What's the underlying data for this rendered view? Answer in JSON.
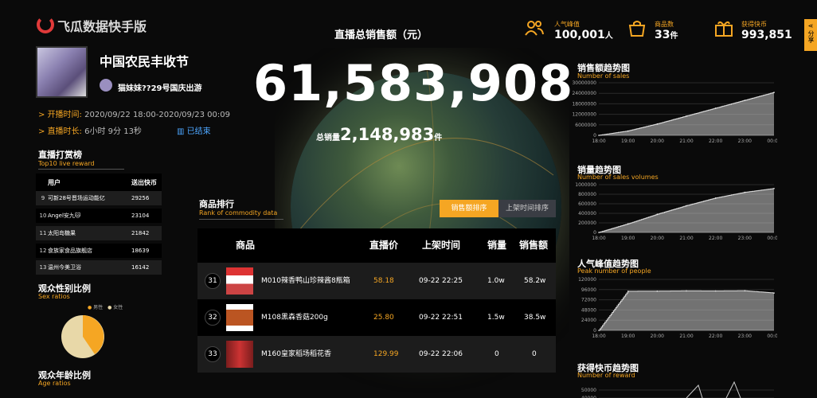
{
  "brand": {
    "name": "飞瓜数据快手版"
  },
  "header": {
    "title": "直播总销售额（元）",
    "share_label": "分享"
  },
  "kpis": [
    {
      "label": "人气峰值",
      "value": "100,001",
      "unit": "人",
      "icon": "people-icon"
    },
    {
      "label": "商品数",
      "value": "33",
      "unit": "件",
      "icon": "bag-icon"
    },
    {
      "label": "获得快币",
      "value": "993,851",
      "unit": "",
      "icon": "gift-icon"
    }
  ],
  "live": {
    "title": "中国农民丰收节",
    "streamer": "猫妹妹??29号国庆出游",
    "start_label": "开播时间:",
    "start_value": "2020/09/22 18:00-2020/09/23 00:09",
    "duration_label": "直播时长:",
    "duration_value": "6小时 9分 13秒",
    "status": "已结束"
  },
  "total_sales": "61,583,908",
  "total_volume_label": "总销量",
  "total_volume": "2,148,983",
  "total_volume_unit": "件",
  "reward": {
    "title": "直播打赏榜",
    "subtitle": "Top10 live reward",
    "col_user": "用户",
    "col_coins": "送出快币",
    "rows": [
      {
        "rank": "9",
        "name": "可新28号晋场运动能亿",
        "coins": "29256"
      },
      {
        "rank": "10",
        "name": "Angel安九🐱",
        "coins": "23104"
      },
      {
        "rank": "11",
        "name": "太阳岛糖果",
        "coins": "21842"
      },
      {
        "rank": "12",
        "name": "食族家食品旗舰店",
        "coins": "18639"
      },
      {
        "rank": "13",
        "name": "温州今美卫浴",
        "coins": "16142"
      }
    ]
  },
  "gender": {
    "title": "观众性别比例",
    "subtitle": "Sex ratios",
    "legend": [
      "男性",
      "女性"
    ],
    "colors": {
      "male": "#f5a623",
      "female": "#e8d8a8"
    }
  },
  "age": {
    "title": "观众年龄比例",
    "subtitle": "Age ratios"
  },
  "ranking": {
    "title": "商品排行",
    "subtitle": "Rank of commodity data",
    "tab_sales": "销售额排序",
    "tab_time": "上架时间排序",
    "headers": {
      "product": "商品",
      "price": "直播价",
      "time": "上架时间",
      "volume": "销量",
      "amount": "销售额"
    },
    "rows": [
      {
        "rank": "31",
        "name": "M010辣香鸭山珍辣酱8瓶箱",
        "price": "58.18",
        "time": "09-22 22:25",
        "volume": "1.0w",
        "amount": "58.2w"
      },
      {
        "rank": "32",
        "name": "M108黑森香菇200g",
        "price": "25.80",
        "time": "09-22 22:51",
        "volume": "1.5w",
        "amount": "38.5w"
      },
      {
        "rank": "33",
        "name": "M160皇家稻场稻花香",
        "price": "129.99",
        "time": "09-22 22:06",
        "volume": "0",
        "amount": "0"
      }
    ]
  },
  "charts": {
    "sales_trend": {
      "title": "销售额趋势图",
      "subtitle": "Number of sales"
    },
    "volume_trend": {
      "title": "销量趋势图",
      "subtitle": "Number of sales volumes"
    },
    "peak_trend": {
      "title": "人气峰值趋势图",
      "subtitle": "Peak number of people"
    },
    "reward_trend": {
      "title": "获得快币趋势图",
      "subtitle": "Number of reward"
    }
  },
  "chart_data": [
    {
      "type": "area",
      "x": [
        "18:00",
        "19:00",
        "20:00",
        "21:00",
        "22:00",
        "23:00",
        "00:00"
      ],
      "yticks": [
        "0",
        "6000000",
        "12000000",
        "18000000",
        "24000000",
        "30000000"
      ],
      "ylim": [
        0,
        30000000
      ],
      "values": [
        0,
        2500000,
        6500000,
        11000000,
        15500000,
        20000000,
        24500000
      ]
    },
    {
      "type": "area",
      "x": [
        "18:00",
        "19:00",
        "20:00",
        "21:00",
        "22:00",
        "23:00",
        "00:00"
      ],
      "yticks": [
        "0",
        "200000",
        "400000",
        "600000",
        "800000",
        "1000000"
      ],
      "ylim": [
        0,
        1000000
      ],
      "values": [
        0,
        180000,
        380000,
        560000,
        720000,
        840000,
        920000
      ]
    },
    {
      "type": "area",
      "x": [
        "18:00",
        "19:00",
        "20:00",
        "21:00",
        "22:00",
        "23:00",
        "00:00"
      ],
      "yticks": [
        "0",
        "24000",
        "48000",
        "72000",
        "96000",
        "120000"
      ],
      "ylim": [
        0,
        120000
      ],
      "values": [
        0,
        92000,
        92500,
        93000,
        92800,
        93200,
        88000
      ]
    },
    {
      "type": "area",
      "x": [],
      "yticks": [
        "40000",
        "50000"
      ],
      "ylim": [
        40000,
        60000
      ],
      "values": []
    }
  ]
}
